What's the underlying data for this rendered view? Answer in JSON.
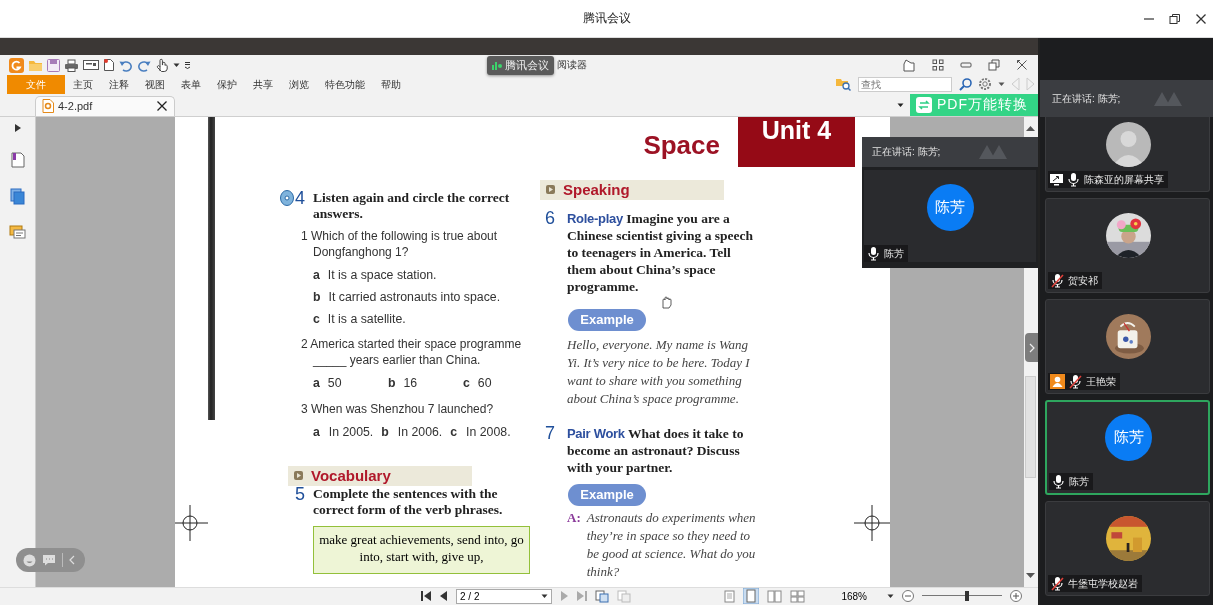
{
  "window": {
    "title": "腾讯会议"
  },
  "reader": {
    "meeting_badge": "腾讯会议",
    "title_tail": "阅读器",
    "menu": [
      {
        "label": "文件",
        "selected": true
      },
      {
        "label": "主页",
        "selected": false
      },
      {
        "label": "注释",
        "selected": false
      },
      {
        "label": "视图",
        "selected": false
      },
      {
        "label": "表单",
        "selected": false
      },
      {
        "label": "保护",
        "selected": false
      },
      {
        "label": "共享",
        "selected": false
      },
      {
        "label": "浏览",
        "selected": false
      },
      {
        "label": "特色功能",
        "selected": false
      },
      {
        "label": "帮助",
        "selected": false
      }
    ],
    "search": {
      "placeholder": "查找"
    },
    "tabs": [
      {
        "label": "4-2.pdf",
        "selected": true
      }
    ],
    "convert_button": "PDF万能转换",
    "page": {
      "title": "Space",
      "unit": "Unit 4",
      "left_column": [
        {
          "kind": "exercise",
          "number": "4",
          "audio": true,
          "title": "Listen again and circle the correct answers.",
          "questions": [
            {
              "text": "1 Which of the following is true about Dongfanghong 1?",
              "kind": "column",
              "options": [
                {
                  "letter": "a",
                  "text": "It is a space station."
                },
                {
                  "letter": "b",
                  "text": "It carried astronauts into space."
                },
                {
                  "letter": "c",
                  "text": "It is a satellite."
                }
              ]
            },
            {
              "text": "2 America started their space programme _____ years earlier than China.",
              "kind": "row",
              "options": [
                {
                  "letter": "a",
                  "text": "50"
                },
                {
                  "letter": "b",
                  "text": "16"
                },
                {
                  "letter": "c",
                  "text": "60"
                }
              ]
            },
            {
              "text": "3 When was Shenzhou 7 launched?",
              "kind": "inline",
              "options": [
                {
                  "letter": "a",
                  "text": "In 2005."
                },
                {
                  "letter": "b",
                  "text": "In 2006."
                },
                {
                  "letter": "c",
                  "text": "In 2008."
                }
              ]
            }
          ]
        },
        {
          "kind": "section",
          "title": "Vocabulary"
        },
        {
          "kind": "exercise",
          "number": "5",
          "audio": false,
          "title": "Complete the sentences with the correct form of the verb phrases.",
          "word_box": "make great achievements, send into, go into, start with, give up,"
        }
      ],
      "right_column": [
        {
          "kind": "section",
          "title": "Speaking"
        },
        {
          "kind": "task",
          "number": "6",
          "tag": "Role-play",
          "text": "Imagine you are a Chinese scientist giving a speech to teenagers in America. Tell them about China’s space programme.",
          "example": {
            "label": "Example",
            "text": "Hello, everyone. My name is Wang Yi. It’s very nice to be here. Today I want to share with you something about China’s space programme."
          }
        },
        {
          "kind": "task",
          "number": "7",
          "tag": "Pair Work",
          "text": "What does it take to become an astronaut? Discuss with your partner.",
          "example": {
            "label": "Example",
            "speaker": "A:",
            "text": "Astronauts do experiments when they’re in space so they need to be good at science. What do you think?"
          }
        }
      ]
    },
    "status_bar": {
      "page_field": "2 / 2",
      "zoom": "168%",
      "zoom_slider": {
        "level": 0.56
      }
    }
  },
  "speaker_popup": {
    "speaking": "正在讲话: 陈芳;",
    "avatar": "陈芳",
    "name": "陈芳",
    "muted": false
  },
  "participants": {
    "speaking": "正在讲话: 陈芳;",
    "tiles": [
      {
        "name": "陈森亚的屏幕共享",
        "avatar": {
          "kind": "silhouette"
        },
        "screen_share": true,
        "person_badge": false,
        "muted": false,
        "selected": false
      },
      {
        "name": "贺安祁",
        "screen_share": false,
        "person_badge": false,
        "muted": true,
        "selected": false
      },
      {
        "name": "王艳荣",
        "screen_share": false,
        "person_badge": true,
        "muted": true,
        "selected": false
      },
      {
        "name": "陈芳",
        "avatar": {
          "kind": "initials",
          "text": "陈芳"
        },
        "screen_share": false,
        "person_badge": false,
        "muted": false,
        "selected": true
      },
      {
        "name": "牛堡屯学校赵岩",
        "screen_share": false,
        "person_badge": false,
        "muted": true,
        "selected": false
      }
    ]
  }
}
